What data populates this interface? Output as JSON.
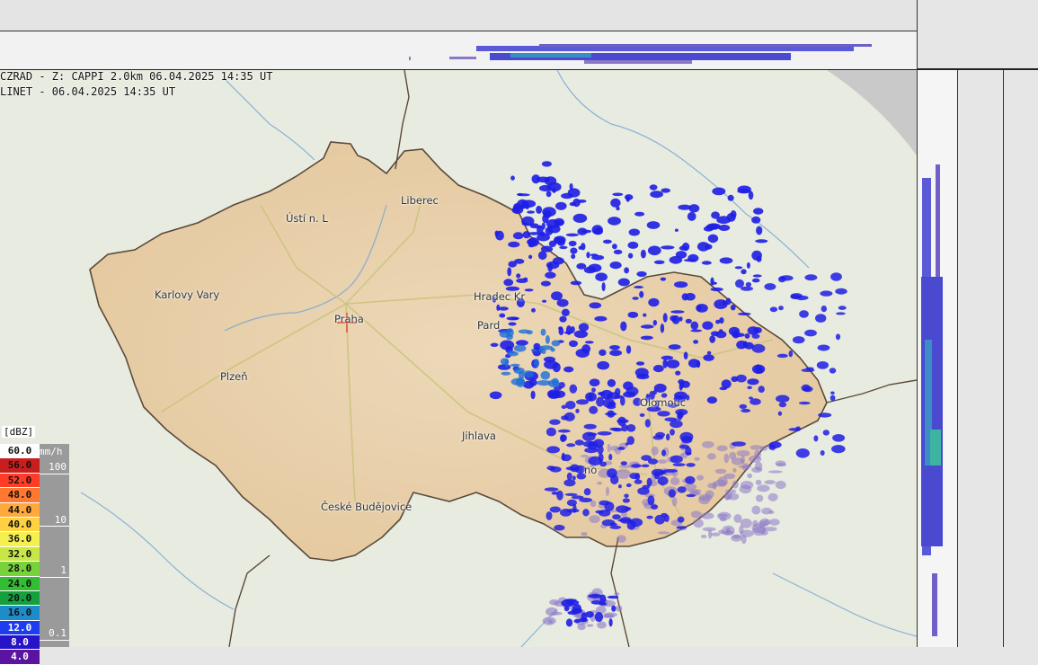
{
  "header": {
    "radar_line": "CZRAD - Z: CAPPI 2.0km 06.04.2025 14:35 UT",
    "lightning_line": "LINET - 06.04.2025 14:35 UT"
  },
  "cities": [
    {
      "name": "Liberec"
    },
    {
      "name": "Ústí n. L"
    },
    {
      "name": "Karlovy Vary"
    },
    {
      "name": "Praha"
    },
    {
      "name": "Hradec Kr"
    },
    {
      "name": "Pard"
    },
    {
      "name": "Plzeň"
    },
    {
      "name": "Olomouc"
    },
    {
      "name": "Jihlava"
    },
    {
      "name": "no"
    },
    {
      "name": "České Budějovice"
    }
  ],
  "legend": {
    "unit_label": "[dBZ]",
    "rate_unit": "mm/h",
    "levels": [
      {
        "label": "60.0",
        "color": "#ffffff"
      },
      {
        "label": "56.0",
        "color": "#c81e1e"
      },
      {
        "label": "52.0",
        "color": "#ff3c28"
      },
      {
        "label": "48.0",
        "color": "#ff7830"
      },
      {
        "label": "44.0",
        "color": "#ffa83c"
      },
      {
        "label": "40.0",
        "color": "#ffd040"
      },
      {
        "label": "36.0",
        "color": "#f5f050"
      },
      {
        "label": "32.0",
        "color": "#c8e646"
      },
      {
        "label": "28.0",
        "color": "#78d23c"
      },
      {
        "label": "24.0",
        "color": "#32be32"
      },
      {
        "label": "20.0",
        "color": "#14a03c"
      },
      {
        "label": "16.0",
        "color": "#1e8cc8"
      },
      {
        "label": "12.0",
        "color": "#1e3cf0"
      },
      {
        "label": "8.0",
        "color": "#2814c8"
      },
      {
        "label": "4.0",
        "color": "#5a14a0"
      }
    ],
    "rate_labels": [
      {
        "label": "100"
      },
      {
        "label": "10"
      },
      {
        "label": "1"
      },
      {
        "label": "0.1"
      }
    ]
  },
  "colors": {
    "border": "#5a4a3a",
    "echo_strong": "#1e1ee6",
    "echo_weak": "#8c78c8",
    "river": "#6fa3d6",
    "road": "#c9c37a"
  }
}
